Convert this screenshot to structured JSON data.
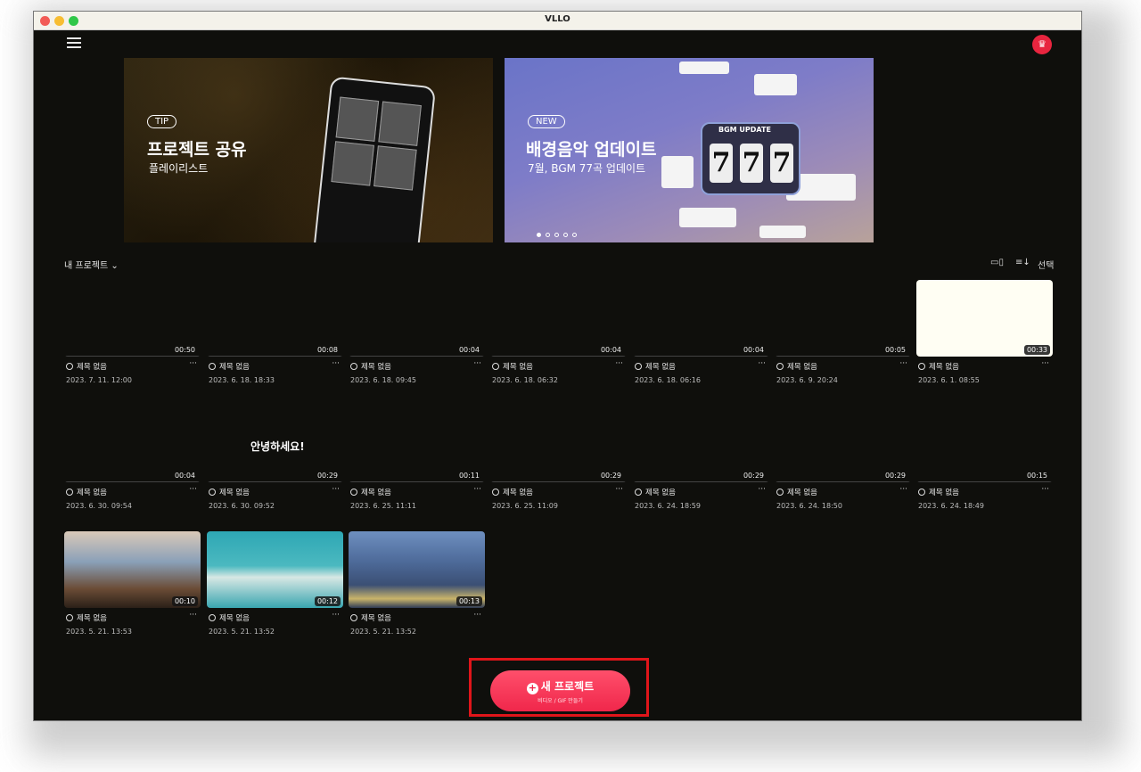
{
  "window": {
    "title": "VLLO"
  },
  "banners": [
    {
      "tag": "TIP",
      "title": "프로젝트 공유",
      "subtitle": "플레이리스트"
    },
    {
      "tag": "NEW",
      "title": "배경음악 업데이트",
      "subtitle": "7월, BGM 77곡 업데이트",
      "art_label": "BGM UPDATE",
      "digits": [
        "7",
        "7",
        "7"
      ]
    }
  ],
  "section": {
    "label": "내 프로젝트 ⌄"
  },
  "toolbar": {
    "select_label": "선택"
  },
  "projects_row1": [
    {
      "duration": "00:50",
      "name": "제목 없음",
      "date": "2023. 7. 11. 12:00"
    },
    {
      "duration": "00:08",
      "name": "제목 없음",
      "date": "2023. 6. 18. 18:33"
    },
    {
      "duration": "00:04",
      "name": "제목 없음",
      "date": "2023. 6. 18. 09:45"
    },
    {
      "duration": "00:04",
      "name": "제목 없음",
      "date": "2023. 6. 18. 06:32"
    },
    {
      "duration": "00:04",
      "name": "제목 없음",
      "date": "2023. 6. 18. 06:16"
    },
    {
      "duration": "00:05",
      "name": "제목 없음",
      "date": "2023. 6. 9. 20:24"
    },
    {
      "duration": "00:33",
      "name": "제목 없음",
      "date": "2023. 6. 1. 08:55"
    }
  ],
  "projects_row2": [
    {
      "duration": "00:04",
      "name": "제목 없음",
      "date": "2023. 6. 30. 09:54"
    },
    {
      "duration": "00:29",
      "name": "제목 없음",
      "date": "2023. 6. 30. 09:52"
    },
    {
      "duration": "00:11",
      "name": "제목 없음",
      "date": "2023. 6. 25. 11:11"
    },
    {
      "duration": "00:29",
      "name": "제목 없음",
      "date": "2023. 6. 25. 11:09"
    },
    {
      "duration": "00:29",
      "name": "제목 없음",
      "date": "2023. 6. 24. 18:59"
    },
    {
      "duration": "00:29",
      "name": "제목 없음",
      "date": "2023. 6. 24. 18:50"
    },
    {
      "duration": "00:15",
      "name": "제목 없음",
      "date": "2023. 6. 24. 18:49"
    }
  ],
  "projects_row3": [
    {
      "duration": "00:10",
      "name": "제목 없음",
      "date": "2023. 5. 21. 13:53"
    },
    {
      "duration": "00:12",
      "name": "제목 없음",
      "date": "2023. 5. 21. 13:52"
    },
    {
      "duration": "00:13",
      "name": "제목 없음",
      "date": "2023. 5. 21. 13:52"
    }
  ],
  "overlay_text": "안녕하세요!",
  "new_project": {
    "label": "새 프로젝트",
    "sub": "비디오 / GIF 만들기"
  },
  "colors": {
    "accent": "#f0274b",
    "highlight_box": "#e0151a",
    "background": "#0f0f0c"
  }
}
